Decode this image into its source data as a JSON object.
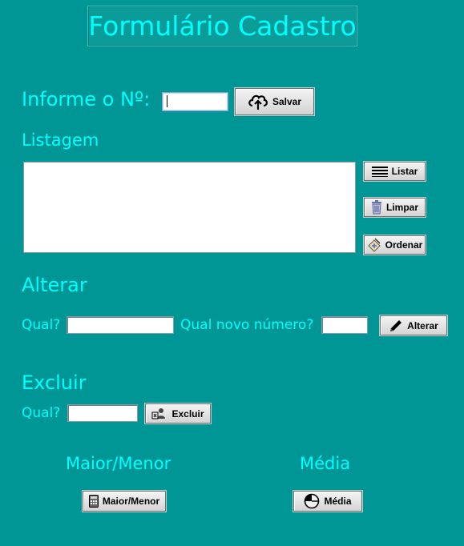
{
  "window": {
    "title": "Formulário Cadastro"
  },
  "entry": {
    "label": "Informe o Nº:",
    "value": "",
    "save_button": "Salvar"
  },
  "listing": {
    "label": "Listagem",
    "items": [],
    "buttons": {
      "list": "Listar",
      "clear": "Limpar",
      "sort": "Ordenar"
    }
  },
  "edit": {
    "section_title": "Alterar",
    "which_label": "Qual?",
    "which_value": "",
    "new_number_label": "Qual novo número?",
    "new_number_value": "",
    "button": "Alterar"
  },
  "delete": {
    "section_title": "Excluir",
    "which_label": "Qual?",
    "which_value": "",
    "button": "Excluir"
  },
  "stats": {
    "max_min_title": "Maior/Menor",
    "max_min_button": "Maior/Menor",
    "average_title": "Média",
    "average_button": "Média"
  },
  "colors": {
    "background": "#009696",
    "accent_text": "#00ffff"
  }
}
